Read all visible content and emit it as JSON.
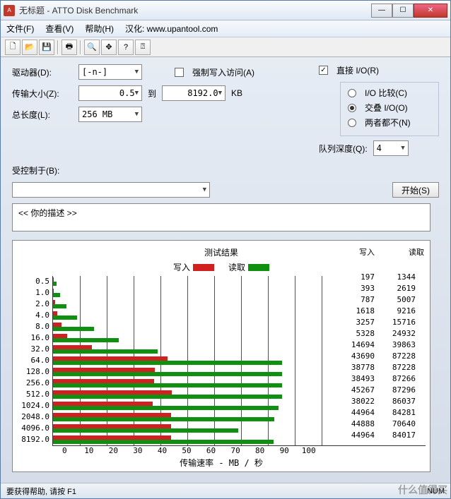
{
  "window": {
    "title": "无标题 - ATTO Disk Benchmark"
  },
  "menu": {
    "file": "文件(F)",
    "view": "查看(V)",
    "help": "帮助(H)",
    "sinicize": "汉化: www.upantool.com"
  },
  "form": {
    "drive_label": "驱动器(D):",
    "drive_value": "[-n-]",
    "force_write": "强制写入访问(A)",
    "direct_io": "直接 I/O(R)",
    "transfer_label": "传输大小(Z):",
    "transfer_from": "0.5",
    "to_label": "到",
    "transfer_to": "8192.0",
    "kb": "KB",
    "io_compare": "I/O 比较(C)",
    "overlapped": "交叠 I/O(O)",
    "neither": "两者都不(N)",
    "total_len_label": "总长度(L):",
    "total_len_value": "256 MB",
    "queue_label": "队列深度(Q):",
    "queue_value": "4",
    "controlled_label": "受控制于(B):",
    "controlled_value": "",
    "start": "开始(S)",
    "desc": "<<  你的描述  >>"
  },
  "chart_data": {
    "type": "bar",
    "title": "测试结果",
    "legend": {
      "write": "写入",
      "read": "读取"
    },
    "xlabel": "传输速率 - MB / 秒",
    "xmax": 100,
    "xticks": [
      0,
      10,
      20,
      30,
      40,
      50,
      60,
      70,
      80,
      90,
      100
    ],
    "header": {
      "write": "写入",
      "read": "读取"
    },
    "categories": [
      "0.5",
      "1.0",
      "2.0",
      "4.0",
      "8.0",
      "16.0",
      "32.0",
      "64.0",
      "128.0",
      "256.0",
      "512.0",
      "1024.0",
      "2048.0",
      "4096.0",
      "8192.0"
    ],
    "series": [
      {
        "name": "写入",
        "values_kb": [
          197,
          393,
          787,
          1618,
          3257,
          5328,
          14694,
          43690,
          38778,
          38493,
          45267,
          38022,
          44964,
          44888,
          44964
        ]
      },
      {
        "name": "读取",
        "values_kb": [
          1344,
          2619,
          5007,
          9216,
          15716,
          24932,
          39863,
          87228,
          87228,
          87266,
          87296,
          86037,
          84281,
          70640,
          84017
        ]
      }
    ]
  },
  "status": {
    "help": "要获得帮助, 请按 F1",
    "num": "NUM"
  },
  "watermark": "什么值得买"
}
